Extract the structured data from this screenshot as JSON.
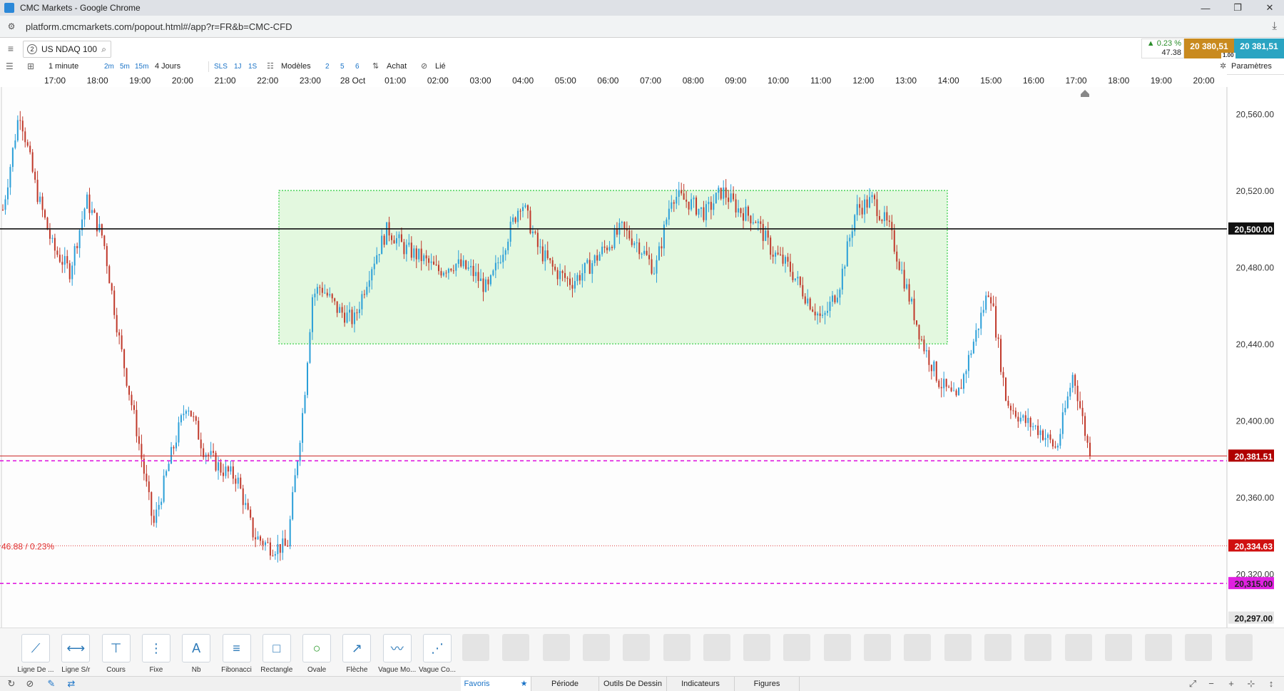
{
  "window": {
    "title": "CMC Markets - Google Chrome",
    "minimize": "—",
    "maximize": "❐",
    "close": "✕"
  },
  "browser": {
    "url": "platform.cmcmarkets.com/popout.html#/app?r=FR&b=CMC-CFD"
  },
  "instrument": {
    "number": "2",
    "name": "US NDAQ 100"
  },
  "quote": {
    "change_pct": "▲ 0.23 %",
    "change_pts": "47.38",
    "sell": "20 380,51",
    "buy": "20 381,51",
    "spread": "1.00"
  },
  "toolbar": {
    "interval": "1 minute",
    "intervals": [
      "2m",
      "5m",
      "15m"
    ],
    "range": "4 Jours",
    "ranges": [
      "SLS",
      "1J",
      "1S"
    ],
    "templates": "Modèles",
    "layouts": [
      "2",
      "5",
      "6"
    ],
    "buy_label": "Achat",
    "linked_label": "Lié",
    "settings": "Paramètres"
  },
  "chart_data": {
    "type": "candlestick",
    "x_ticks": [
      "17:00",
      "18:00",
      "19:00",
      "20:00",
      "21:00",
      "22:00",
      "23:00",
      "28 Oct",
      "01:00",
      "02:00",
      "03:00",
      "04:00",
      "05:00",
      "06:00",
      "07:00",
      "08:00",
      "09:00",
      "10:00",
      "11:00",
      "12:00",
      "13:00",
      "14:00",
      "15:00",
      "16:00",
      "17:00",
      "18:00",
      "19:00",
      "20:00"
    ],
    "y_ticks": [
      "20,560.00",
      "20,520.00",
      "20,480.00",
      "20,440.00",
      "20,400.00",
      "20,360.00",
      "20,320.00"
    ],
    "ylim": [
      20292,
      20574
    ],
    "close_path": [
      [
        0,
        20510
      ],
      [
        1,
        20562
      ],
      [
        2,
        20520
      ],
      [
        3,
        20490
      ],
      [
        4,
        20478
      ],
      [
        5,
        20515
      ],
      [
        6,
        20495
      ],
      [
        7,
        20440
      ],
      [
        8,
        20395
      ],
      [
        9,
        20345
      ],
      [
        10,
        20380
      ],
      [
        11,
        20410
      ],
      [
        12,
        20385
      ],
      [
        13,
        20375
      ],
      [
        14,
        20370
      ],
      [
        15,
        20340
      ],
      [
        16,
        20334
      ],
      [
        17,
        20334
      ],
      [
        18,
        20410
      ],
      [
        18.5,
        20465
      ],
      [
        19,
        20470
      ],
      [
        20,
        20458
      ],
      [
        21,
        20452
      ],
      [
        22,
        20480
      ],
      [
        23,
        20500
      ],
      [
        24,
        20490
      ],
      [
        25,
        20485
      ],
      [
        26,
        20478
      ],
      [
        27,
        20482
      ],
      [
        28,
        20478
      ],
      [
        29,
        20468
      ],
      [
        30,
        20492
      ],
      [
        31,
        20515
      ],
      [
        32,
        20490
      ],
      [
        33,
        20478
      ],
      [
        34,
        20472
      ],
      [
        35,
        20480
      ],
      [
        36,
        20490
      ],
      [
        37,
        20500
      ],
      [
        38,
        20492
      ],
      [
        39,
        20478
      ],
      [
        40,
        20518
      ],
      [
        41,
        20514
      ],
      [
        42,
        20508
      ],
      [
        43,
        20520
      ],
      [
        44,
        20510
      ],
      [
        45,
        20505
      ],
      [
        46,
        20488
      ],
      [
        47,
        20480
      ],
      [
        48,
        20465
      ],
      [
        49,
        20452
      ],
      [
        50,
        20470
      ],
      [
        51,
        20510
      ],
      [
        52,
        20515
      ],
      [
        53,
        20500
      ],
      [
        54,
        20470
      ],
      [
        55,
        20440
      ],
      [
        56,
        20420
      ],
      [
        57,
        20410
      ],
      [
        58,
        20440
      ],
      [
        59,
        20470
      ],
      [
        60,
        20410
      ],
      [
        61,
        20400
      ],
      [
        62,
        20395
      ],
      [
        63,
        20385
      ],
      [
        64,
        20425
      ],
      [
        65,
        20381
      ]
    ],
    "overlays": {
      "range_rectangle": {
        "price_top": 20520,
        "price_bottom": 20440,
        "color": "#2ecc40"
      },
      "horizontal_line": {
        "price": 20500,
        "label": "20,500.00"
      },
      "current_price": {
        "price": 20381.51,
        "label": "20,381.51"
      },
      "magenta_line_upper": {
        "price": 20379
      },
      "previous_close": {
        "price": 20334.63,
        "label": "20,334.63",
        "annotation": "46.88 / 0.23%"
      },
      "magenta_line_lower": {
        "price": 20315,
        "label": "20,315.00"
      },
      "axis_bottom_label": {
        "price": 20297,
        "label": "20,297.00"
      }
    }
  },
  "drawing_tools": [
    {
      "label": "Ligne De ..."
    },
    {
      "label": "Ligne S/r"
    },
    {
      "label": "Cours"
    },
    {
      "label": "Fixe"
    },
    {
      "label": "Nb"
    },
    {
      "label": "Fibonacci"
    },
    {
      "label": "Rectangle"
    },
    {
      "label": "Ovale"
    },
    {
      "label": "Flèche"
    },
    {
      "label": "Vague Mo..."
    },
    {
      "label": "Vague Co..."
    }
  ],
  "status_tabs": [
    "Favoris",
    "Période",
    "Outils De Dessin",
    "Indicateurs",
    "Figures"
  ],
  "colors": {
    "bull": "#2b9fd8",
    "bear": "#c0392b",
    "magenta": "#e020e0",
    "red_label": "#d01010"
  }
}
